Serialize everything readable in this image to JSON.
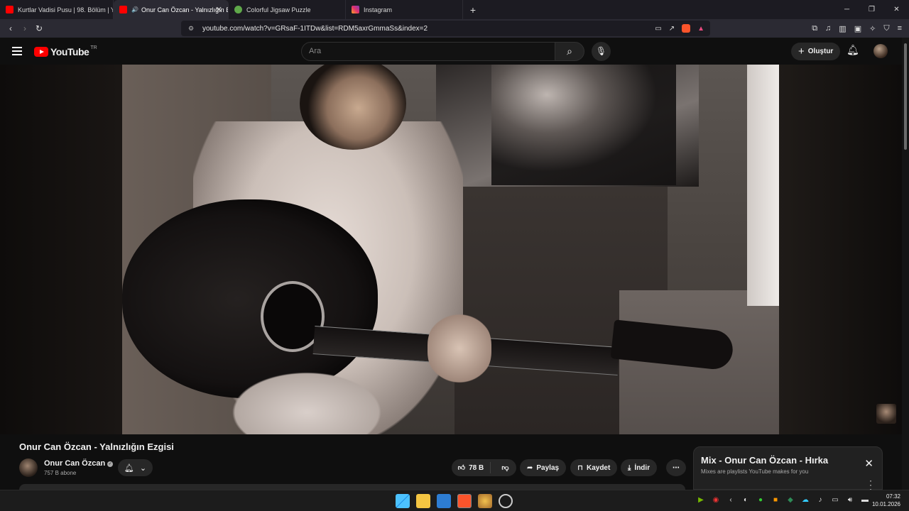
{
  "browser": {
    "tabs": [
      {
        "label": "Kurtlar Vadisi Pusu | 98. Bölüm | Yüks",
        "active": false,
        "favicon": "youtube-icon"
      },
      {
        "label": "Onur Can Özcan - Yalnızlığın E",
        "active": true,
        "favicon": "youtube-icon",
        "audio": true
      },
      {
        "label": "Colorful Jigsaw Puzzle",
        "active": false,
        "favicon": "puzzle-icon"
      },
      {
        "label": "Instagram",
        "active": false,
        "favicon": "instagram-icon"
      }
    ],
    "new_tab": "+",
    "url": "youtube.com/watch?v=GRsaF-1ITDw&list=RDM5axrGmmaSs&index=2"
  },
  "youtube": {
    "logo_text": "YouTube",
    "region": "TR",
    "search_placeholder": "Ara",
    "create_label": "Oluştur"
  },
  "video": {
    "title": "Onur Can Özcan - Yalnızlığın Ezgisi",
    "channel": "Onur Can Özcan",
    "subscribers": "757 B abone",
    "likes": "78 B",
    "share_label": "Paylaş",
    "save_label": "Kaydet",
    "download_label": "İndir"
  },
  "mix": {
    "title": "Mix - Onur Can Özcan - Hırka",
    "subtitle": "Mixes are playlists YouTube makes for you"
  },
  "taskbar": {
    "time": "07:32",
    "date": "10.01.2026"
  },
  "colors": {
    "brand_red": "#ff0000",
    "background": "#0f0f0f",
    "pill": "#272727"
  }
}
